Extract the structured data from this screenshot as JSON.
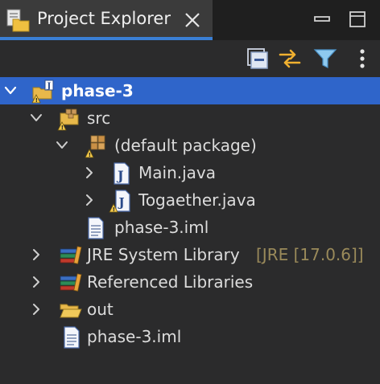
{
  "tab": {
    "title": "Project Explorer"
  },
  "tree": {
    "project": "phase-3",
    "src": "src",
    "default_package": "(default package)",
    "main_java": "Main.java",
    "togaether_java": "Togaether.java",
    "src_iml": "phase-3.iml",
    "jre_library": "JRE System Library",
    "jre_version": "[JRE [17.0.6]]",
    "referenced_libraries": "Referenced Libraries",
    "out": "out",
    "root_iml": "phase-3.iml"
  },
  "colors": {
    "selection": "#2f65ca",
    "tab_underline": "#3a7fd5",
    "decoration": "#9a8a5a",
    "warning": "#f2c94c"
  }
}
